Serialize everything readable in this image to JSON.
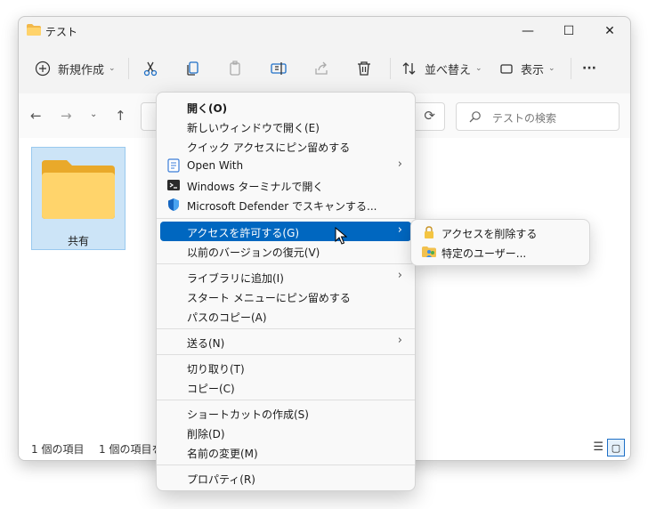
{
  "window": {
    "title": "テスト",
    "controls": {
      "minimize": "—",
      "maximize": "☐",
      "close": "✕"
    }
  },
  "toolbar": {
    "new_label": "新規作成",
    "sort_label": "並べ替え",
    "view_label": "表示",
    "more_label": "···"
  },
  "search": {
    "placeholder": "テストの検索"
  },
  "folder": {
    "name": "共有"
  },
  "status": {
    "item_count": "1 個の項目",
    "selected": "1 個の項目を"
  },
  "context_menu": {
    "items": [
      {
        "label": "開く(O)"
      },
      {
        "label": "新しいウィンドウで開く(E)"
      },
      {
        "label": "クイック アクセスにピン留めする"
      },
      {
        "label": "Open With"
      },
      {
        "label": "Windows ターミナルで開く"
      },
      {
        "label": "Microsoft Defender でスキャンする..."
      },
      {
        "label": "アクセスを許可する(G)"
      },
      {
        "label": "以前のバージョンの復元(V)"
      },
      {
        "label": "ライブラリに追加(I)"
      },
      {
        "label": "スタート メニューにピン留めする"
      },
      {
        "label": "パスのコピー(A)"
      },
      {
        "label": "送る(N)"
      },
      {
        "label": "切り取り(T)"
      },
      {
        "label": "コピー(C)"
      },
      {
        "label": "ショートカットの作成(S)"
      },
      {
        "label": "削除(D)"
      },
      {
        "label": "名前の変更(M)"
      },
      {
        "label": "プロパティ(R)"
      }
    ]
  },
  "submenu": {
    "items": [
      {
        "label": "アクセスを削除する"
      },
      {
        "label": "特定のユーザー..."
      }
    ]
  },
  "colors": {
    "accent": "#0067c0",
    "folder": "#f8c94a",
    "selection": "#cce4f7"
  }
}
